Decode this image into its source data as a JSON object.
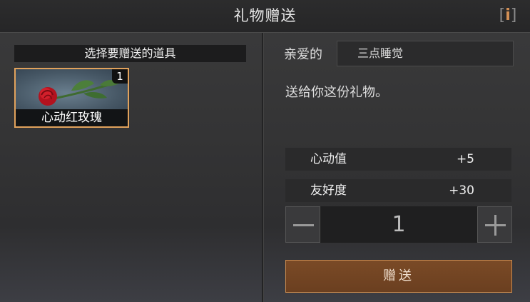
{
  "header": {
    "title": "礼物赠送",
    "info_icon": "i"
  },
  "left_panel": {
    "heading": "选择要赠送的道具",
    "item": {
      "name": "心动红玫瑰",
      "count": "1",
      "icon": "red-rose-icon"
    }
  },
  "right_panel": {
    "recipient_label": "亲爱的",
    "recipient_name": "三点睡觉",
    "message": "送给你这份礼物。",
    "stats": [
      {
        "label": "心动值",
        "value": "+5"
      },
      {
        "label": "友好度",
        "value": "+30"
      }
    ],
    "quantity": "1",
    "gift_button": "赠送"
  },
  "colors": {
    "accent": "#e1a25c",
    "button": "#6b3f20"
  }
}
